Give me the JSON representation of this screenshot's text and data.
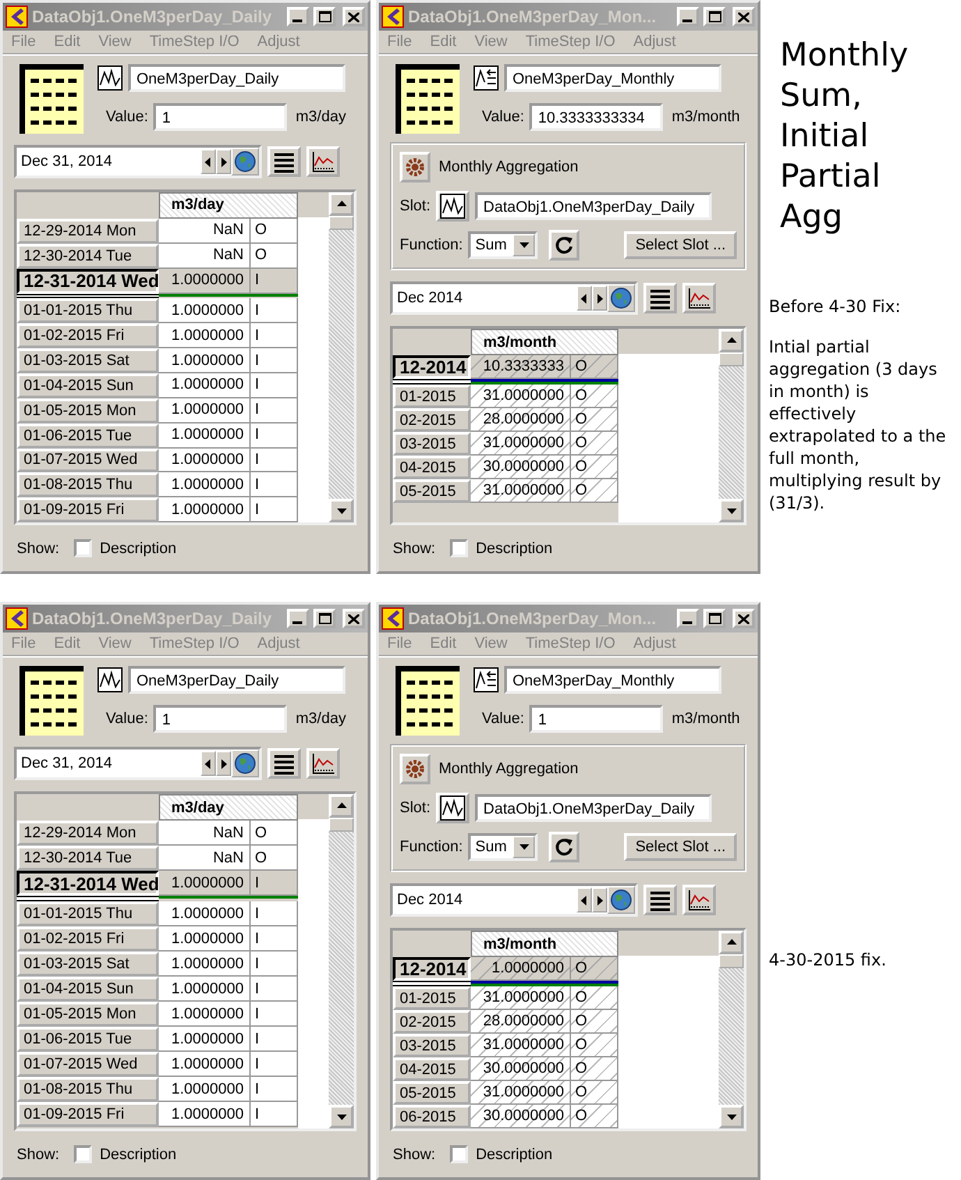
{
  "windows": [
    {
      "kind": "daily",
      "title": "DataObj1.OneM3perDay_Daily",
      "menu": [
        "File",
        "Edit",
        "View",
        "TimeStep I/O",
        "Adjust"
      ],
      "slot_name": "OneM3perDay_Daily",
      "value_label": "Value:",
      "value": "1",
      "units": "m3/day",
      "date": "Dec 31, 2014",
      "column_header": "m3/day",
      "rows": [
        {
          "date": "12-29-2014 Mon",
          "value": "NaN",
          "flag": "O",
          "current": false
        },
        {
          "date": "12-30-2014 Tue",
          "value": "NaN",
          "flag": "O",
          "current": false
        },
        {
          "date": "12-31-2014 Wed",
          "value": "1.0000000",
          "flag": "I",
          "current": true
        },
        {
          "date": "01-01-2015 Thu",
          "value": "1.0000000",
          "flag": "I",
          "current": false
        },
        {
          "date": "01-02-2015 Fri",
          "value": "1.0000000",
          "flag": "I",
          "current": false
        },
        {
          "date": "01-03-2015 Sat",
          "value": "1.0000000",
          "flag": "I",
          "current": false
        },
        {
          "date": "01-04-2015 Sun",
          "value": "1.0000000",
          "flag": "I",
          "current": false
        },
        {
          "date": "01-05-2015 Mon",
          "value": "1.0000000",
          "flag": "I",
          "current": false
        },
        {
          "date": "01-06-2015 Tue",
          "value": "1.0000000",
          "flag": "I",
          "current": false
        },
        {
          "date": "01-07-2015 Wed",
          "value": "1.0000000",
          "flag": "I",
          "current": false
        },
        {
          "date": "01-08-2015 Thu",
          "value": "1.0000000",
          "flag": "I",
          "current": false
        },
        {
          "date": "01-09-2015 Fri",
          "value": "1.0000000",
          "flag": "I",
          "current": false
        }
      ],
      "show_label": "Show:",
      "description_label": "Description",
      "description_checked": false
    },
    {
      "kind": "monthly",
      "title": "DataObj1.OneM3perDay_Mon...",
      "menu": [
        "File",
        "Edit",
        "View",
        "TimeStep I/O",
        "Adjust"
      ],
      "slot_name": "OneM3perDay_Monthly",
      "value_label": "Value:",
      "value": "10.3333333334",
      "units": "m3/month",
      "aggregation": {
        "title": "Monthly Aggregation",
        "slot_label": "Slot:",
        "slot": "DataObj1.OneM3perDay_Daily",
        "function_label": "Function:",
        "function": "Sum",
        "select_button": "Select Slot ..."
      },
      "date": "Dec 2014",
      "column_header": "m3/month",
      "rows": [
        {
          "date": "12-2014",
          "value": "10.3333333",
          "flag": "O",
          "current": true
        },
        {
          "date": "01-2015",
          "value": "31.0000000",
          "flag": "O",
          "current": false
        },
        {
          "date": "02-2015",
          "value": "28.0000000",
          "flag": "O",
          "current": false
        },
        {
          "date": "03-2015",
          "value": "31.0000000",
          "flag": "O",
          "current": false
        },
        {
          "date": "04-2015",
          "value": "30.0000000",
          "flag": "O",
          "current": false
        },
        {
          "date": "05-2015",
          "value": "31.0000000",
          "flag": "O",
          "current": false
        }
      ],
      "show_label": "Show:",
      "description_label": "Description",
      "description_checked": false
    },
    {
      "kind": "daily",
      "title": "DataObj1.OneM3perDay_Daily",
      "menu": [
        "File",
        "Edit",
        "View",
        "TimeStep I/O",
        "Adjust"
      ],
      "slot_name": "OneM3perDay_Daily",
      "value_label": "Value:",
      "value": "1",
      "units": "m3/day",
      "date": "Dec 31, 2014",
      "column_header": "m3/day",
      "rows": [
        {
          "date": "12-29-2014 Mon",
          "value": "NaN",
          "flag": "O",
          "current": false
        },
        {
          "date": "12-30-2014 Tue",
          "value": "NaN",
          "flag": "O",
          "current": false
        },
        {
          "date": "12-31-2014 Wed",
          "value": "1.0000000",
          "flag": "I",
          "current": true
        },
        {
          "date": "01-01-2015 Thu",
          "value": "1.0000000",
          "flag": "I",
          "current": false
        },
        {
          "date": "01-02-2015 Fri",
          "value": "1.0000000",
          "flag": "I",
          "current": false
        },
        {
          "date": "01-03-2015 Sat",
          "value": "1.0000000",
          "flag": "I",
          "current": false
        },
        {
          "date": "01-04-2015 Sun",
          "value": "1.0000000",
          "flag": "I",
          "current": false
        },
        {
          "date": "01-05-2015 Mon",
          "value": "1.0000000",
          "flag": "I",
          "current": false
        },
        {
          "date": "01-06-2015 Tue",
          "value": "1.0000000",
          "flag": "I",
          "current": false
        },
        {
          "date": "01-07-2015 Wed",
          "value": "1.0000000",
          "flag": "I",
          "current": false
        },
        {
          "date": "01-08-2015 Thu",
          "value": "1.0000000",
          "flag": "I",
          "current": false
        },
        {
          "date": "01-09-2015 Fri",
          "value": "1.0000000",
          "flag": "I",
          "current": false
        }
      ],
      "show_label": "Show:",
      "description_label": "Description",
      "description_checked": false
    },
    {
      "kind": "monthly",
      "title": "DataObj1.OneM3perDay_Mon...",
      "menu": [
        "File",
        "Edit",
        "View",
        "TimeStep I/O",
        "Adjust"
      ],
      "slot_name": "OneM3perDay_Monthly",
      "value_label": "Value:",
      "value": "1",
      "units": "m3/month",
      "aggregation": {
        "title": "Monthly Aggregation",
        "slot_label": "Slot:",
        "slot": "DataObj1.OneM3perDay_Daily",
        "function_label": "Function:",
        "function": "Sum",
        "select_button": "Select Slot ..."
      },
      "date": "Dec 2014",
      "column_header": "m3/month",
      "rows": [
        {
          "date": "12-2014",
          "value": "1.0000000",
          "flag": "O",
          "current": true
        },
        {
          "date": "01-2015",
          "value": "31.0000000",
          "flag": "O",
          "current": false
        },
        {
          "date": "02-2015",
          "value": "28.0000000",
          "flag": "O",
          "current": false
        },
        {
          "date": "03-2015",
          "value": "31.0000000",
          "flag": "O",
          "current": false
        },
        {
          "date": "04-2015",
          "value": "30.0000000",
          "flag": "O",
          "current": false
        },
        {
          "date": "05-2015",
          "value": "31.0000000",
          "flag": "O",
          "current": false
        },
        {
          "date": "06-2015",
          "value": "30.0000000",
          "flag": "O",
          "current": false
        }
      ],
      "show_label": "Show:",
      "description_label": "Description",
      "description_checked": false
    }
  ],
  "notes": [
    {
      "heading": "Monthly Sum, Initial Partial Agg",
      "subheading": "Before 4-30 Fix:",
      "text": "Intial partial aggregation (3 days in month) is effectively extrapolated to a the full month, multiplying result by (31/3)."
    },
    {
      "text": "4-30-2015 fix."
    }
  ]
}
